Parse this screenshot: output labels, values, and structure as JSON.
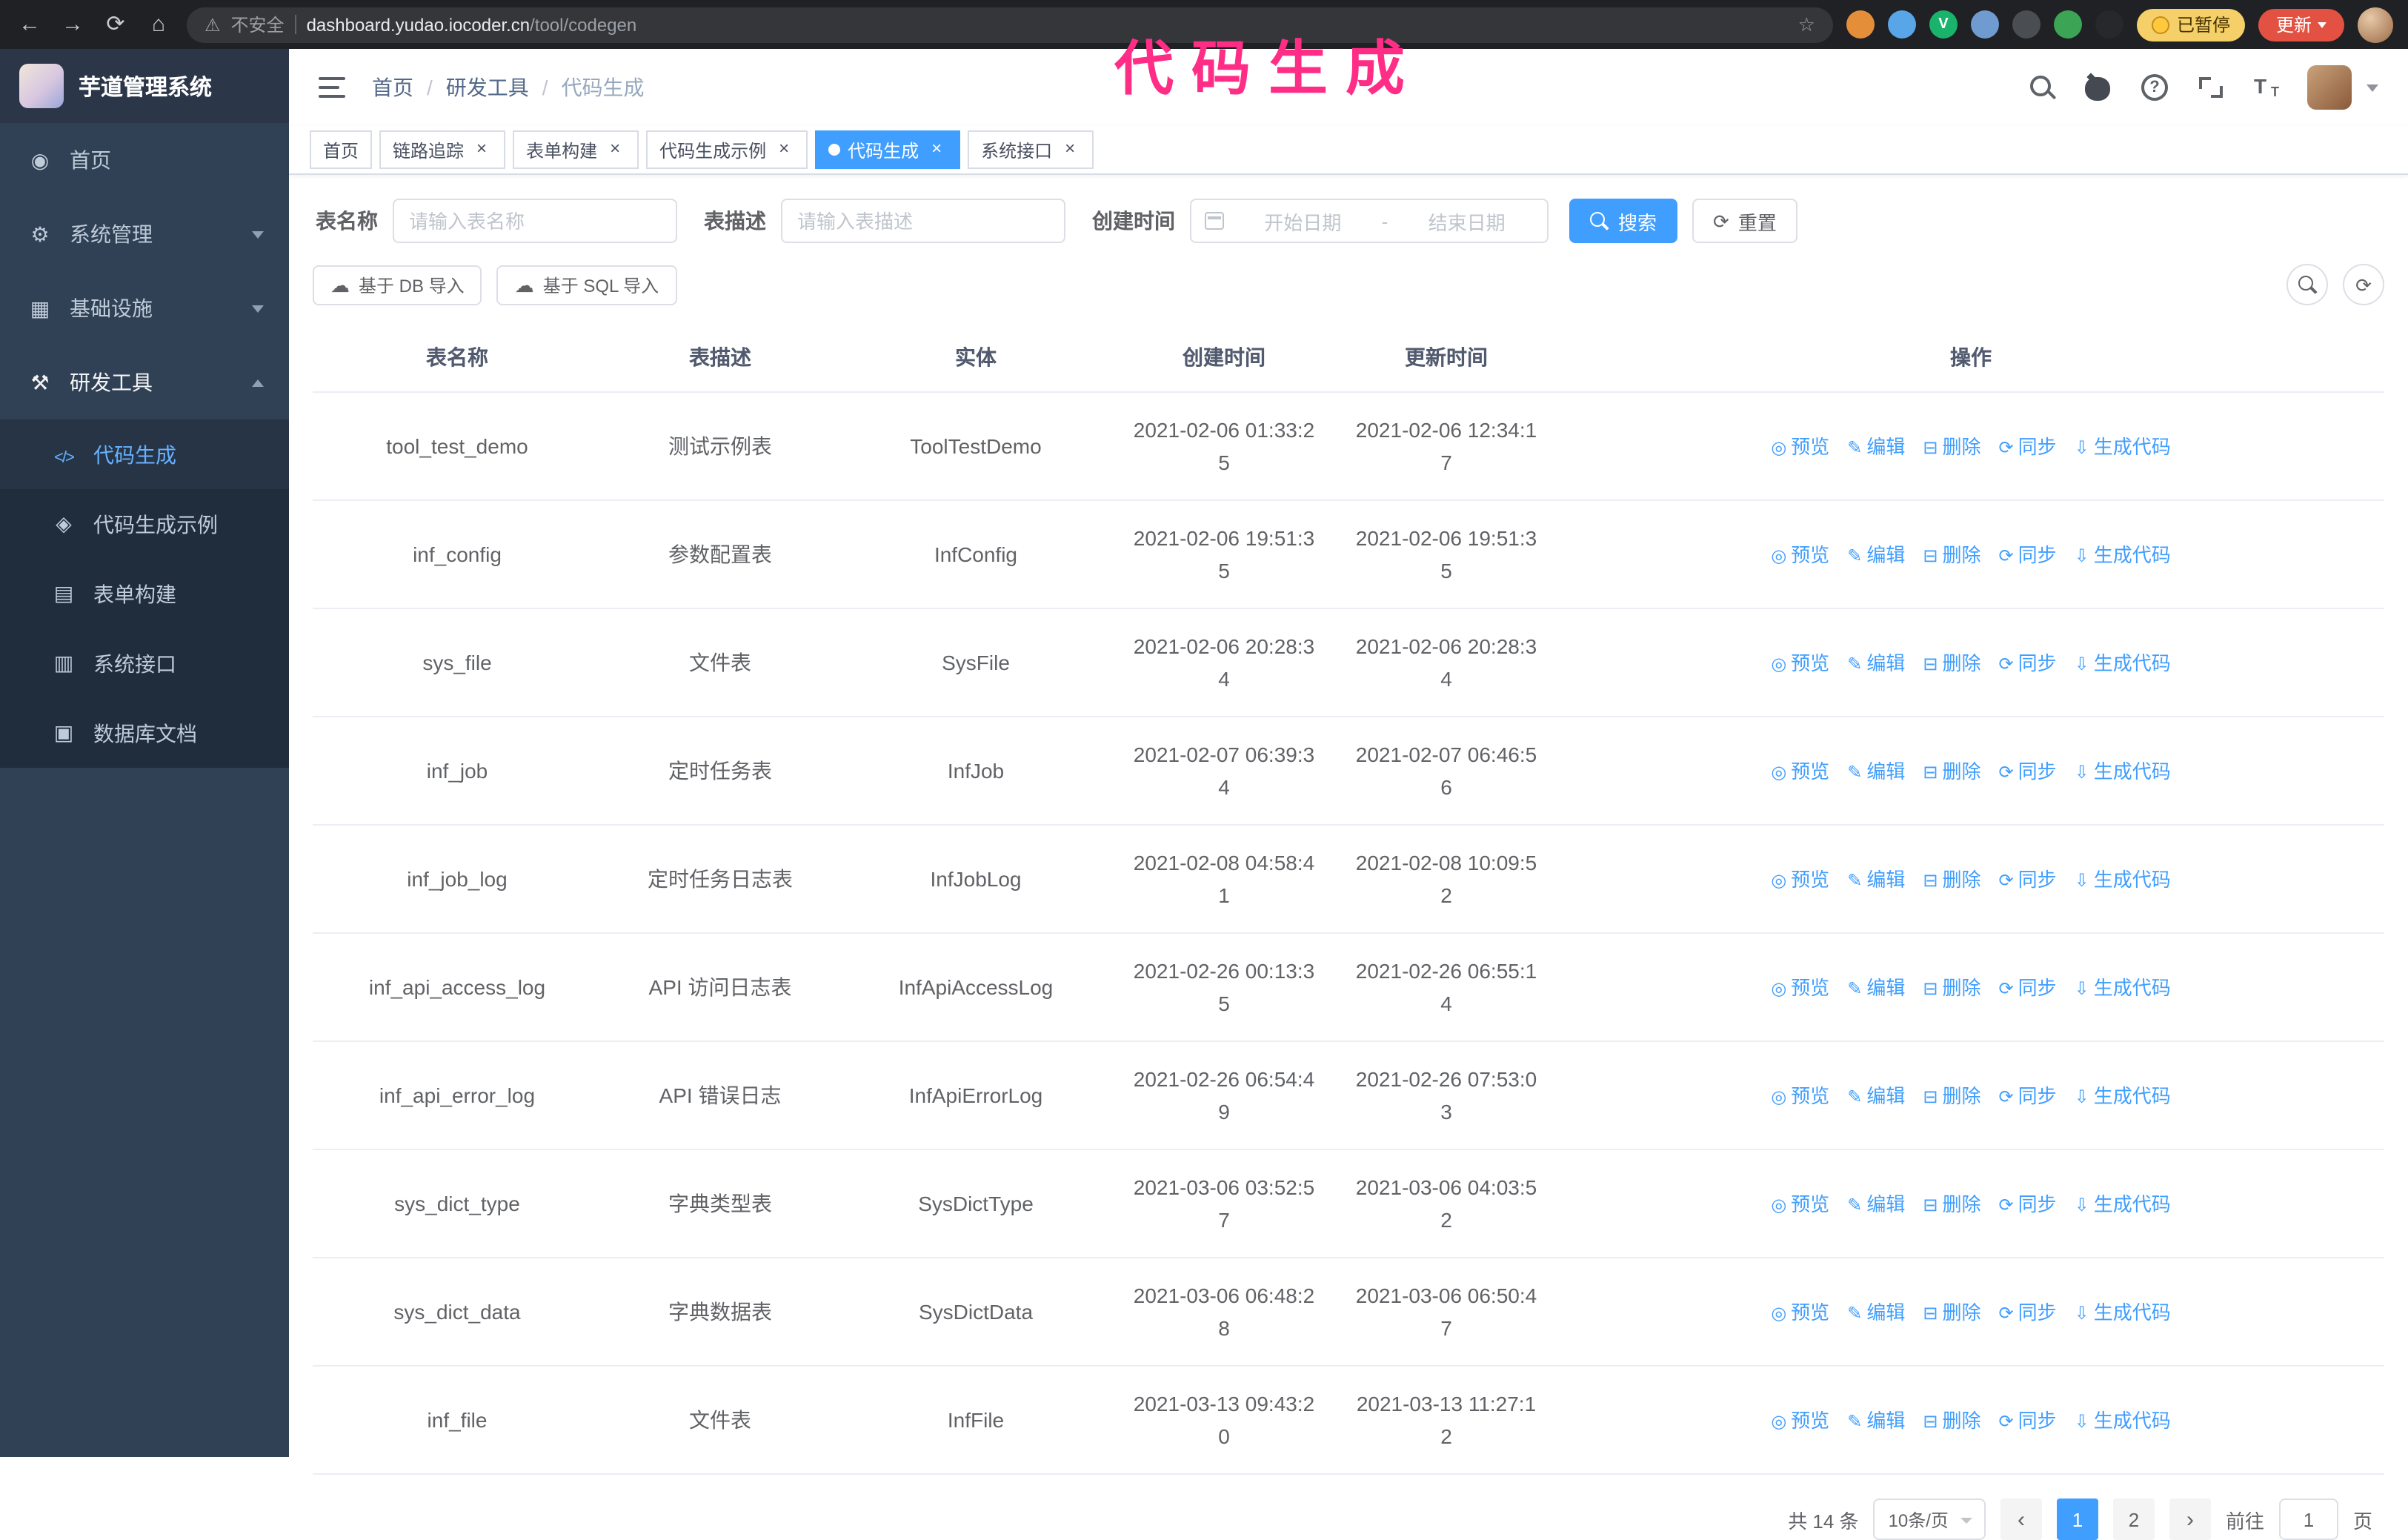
{
  "colors": {
    "accent": "#409eff",
    "sidebar_bg": "#304156",
    "submenu_bg": "#1f2d3d",
    "annotation_pink": "#ff2d85",
    "update_button_red": "#e25141",
    "paused_badge_gold": "#f5cf67"
  },
  "browser": {
    "nav": {
      "back": "←",
      "forward": "→",
      "reload": "⟳",
      "home": "⌂"
    },
    "warning_glyph": "⚠",
    "security_label": "不安全",
    "url_host": "dashboard.yudao.iocoder.cn",
    "url_path": "/tool/codegen",
    "star_glyph": "☆",
    "extensions": [
      {
        "name": "extension-orange-icon",
        "color": "#e58e3a",
        "label": ""
      },
      {
        "name": "extension-blue-drop-icon",
        "color": "#58a6e8",
        "label": ""
      },
      {
        "name": "extension-green-v-icon",
        "color": "#19b36b",
        "label": "V"
      },
      {
        "name": "extension-people-icon",
        "color": "#6f9bd1",
        "label": ""
      },
      {
        "name": "extension-dark-icon",
        "color": "#4a4d52",
        "label": ""
      },
      {
        "name": "extension-leaf-icon",
        "color": "#3ca455",
        "label": ""
      },
      {
        "name": "extension-black-icon",
        "color": "#26282b",
        "label": ""
      }
    ],
    "paused_badge": "已暂停",
    "update_button": "更新"
  },
  "annotation": {
    "text": "代码生成"
  },
  "sidebar": {
    "logo_title": "芋道管理系统",
    "menu": [
      {
        "label": "首页",
        "icon": "home-icon",
        "expandable": false,
        "expanded": false
      },
      {
        "label": "系统管理",
        "icon": "system-icon",
        "expandable": true,
        "expanded": false
      },
      {
        "label": "基础设施",
        "icon": "infra-icon",
        "expandable": true,
        "expanded": false
      },
      {
        "label": "研发工具",
        "icon": "tools-icon",
        "expandable": true,
        "expanded": true
      }
    ],
    "submenu": [
      {
        "label": "代码生成",
        "icon": "codegen-icon",
        "active": true
      },
      {
        "label": "代码生成示例",
        "icon": "example-icon",
        "active": false
      },
      {
        "label": "表单构建",
        "icon": "form-icon",
        "active": false
      },
      {
        "label": "系统接口",
        "icon": "api-icon",
        "active": false
      },
      {
        "label": "数据库文档",
        "icon": "db-icon",
        "active": false
      }
    ]
  },
  "header": {
    "breadcrumb": [
      {
        "label": "首页"
      },
      {
        "label": "研发工具"
      },
      {
        "label": "代码生成"
      }
    ],
    "separator": "/",
    "icons": [
      {
        "name": "search-icon"
      },
      {
        "name": "github-icon"
      },
      {
        "name": "question-icon"
      },
      {
        "name": "fullscreen-icon"
      },
      {
        "name": "fontsize-icon"
      }
    ]
  },
  "tabs": {
    "close_glyph": "×",
    "items": [
      {
        "label": "首页",
        "closable": false,
        "active": false
      },
      {
        "label": "链路追踪",
        "closable": true,
        "active": false
      },
      {
        "label": "表单构建",
        "closable": true,
        "active": false
      },
      {
        "label": "代码生成示例",
        "closable": true,
        "active": false
      },
      {
        "label": "代码生成",
        "closable": true,
        "active": true
      },
      {
        "label": "系统接口",
        "closable": true,
        "active": false
      }
    ]
  },
  "filters": {
    "table_name_label": "表名称",
    "table_name_placeholder": "请输入表名称",
    "table_desc_label": "表描述",
    "table_desc_placeholder": "请输入表描述",
    "create_time_label": "创建时间",
    "date_start_placeholder": "开始日期",
    "date_separator": "-",
    "date_end_placeholder": "结束日期",
    "search_button": "搜索",
    "reset_button": "重置",
    "reset_icon_glyph": "⟳"
  },
  "toolbar": {
    "import_db": "基于 DB 导入",
    "import_sql": "基于 SQL 导入",
    "import_icon_glyph": "☁",
    "refresh_icon_glyph": "⟳"
  },
  "table": {
    "columns": [
      "表名称",
      "表描述",
      "实体",
      "创建时间",
      "更新时间",
      "操作"
    ],
    "actions": [
      "预览",
      "编辑",
      "删除",
      "同步",
      "生成代码"
    ],
    "action_icons": [
      "◎",
      "✎",
      "⊟",
      "⟳",
      "⇩"
    ],
    "rows": [
      {
        "name": "tool_test_demo",
        "desc": "测试示例表",
        "entity": "ToolTestDemo",
        "created": "2021-02-06 01:33:25",
        "updated": "2021-02-06 12:34:17"
      },
      {
        "name": "inf_config",
        "desc": "参数配置表",
        "entity": "InfConfig",
        "created": "2021-02-06 19:51:35",
        "updated": "2021-02-06 19:51:35"
      },
      {
        "name": "sys_file",
        "desc": "文件表",
        "entity": "SysFile",
        "created": "2021-02-06 20:28:34",
        "updated": "2021-02-06 20:28:34"
      },
      {
        "name": "inf_job",
        "desc": "定时任务表",
        "entity": "InfJob",
        "created": "2021-02-07 06:39:34",
        "updated": "2021-02-07 06:46:56"
      },
      {
        "name": "inf_job_log",
        "desc": "定时任务日志表",
        "entity": "InfJobLog",
        "created": "2021-02-08 04:58:41",
        "updated": "2021-02-08 10:09:52"
      },
      {
        "name": "inf_api_access_log",
        "desc": "API 访问日志表",
        "entity": "InfApiAccessLog",
        "created": "2021-02-26 00:13:35",
        "updated": "2021-02-26 06:55:14"
      },
      {
        "name": "inf_api_error_log",
        "desc": "API 错误日志",
        "entity": "InfApiErrorLog",
        "created": "2021-02-26 06:54:49",
        "updated": "2021-02-26 07:53:03"
      },
      {
        "name": "sys_dict_type",
        "desc": "字典类型表",
        "entity": "SysDictType",
        "created": "2021-03-06 03:52:57",
        "updated": "2021-03-06 04:03:52"
      },
      {
        "name": "sys_dict_data",
        "desc": "字典数据表",
        "entity": "SysDictData",
        "created": "2021-03-06 06:48:28",
        "updated": "2021-03-06 06:50:47"
      },
      {
        "name": "inf_file",
        "desc": "文件表",
        "entity": "InfFile",
        "created": "2021-03-13 09:43:20",
        "updated": "2021-03-13 11:27:12"
      }
    ]
  },
  "pagination": {
    "total_text": "共 14 条",
    "page_size": "10条/页",
    "prev_glyph": "‹",
    "next_glyph": "›",
    "pages": [
      {
        "label": "1",
        "active": true
      },
      {
        "label": "2",
        "active": false
      }
    ],
    "goto_label": "前往",
    "goto_value": "1",
    "goto_suffix": "页"
  }
}
